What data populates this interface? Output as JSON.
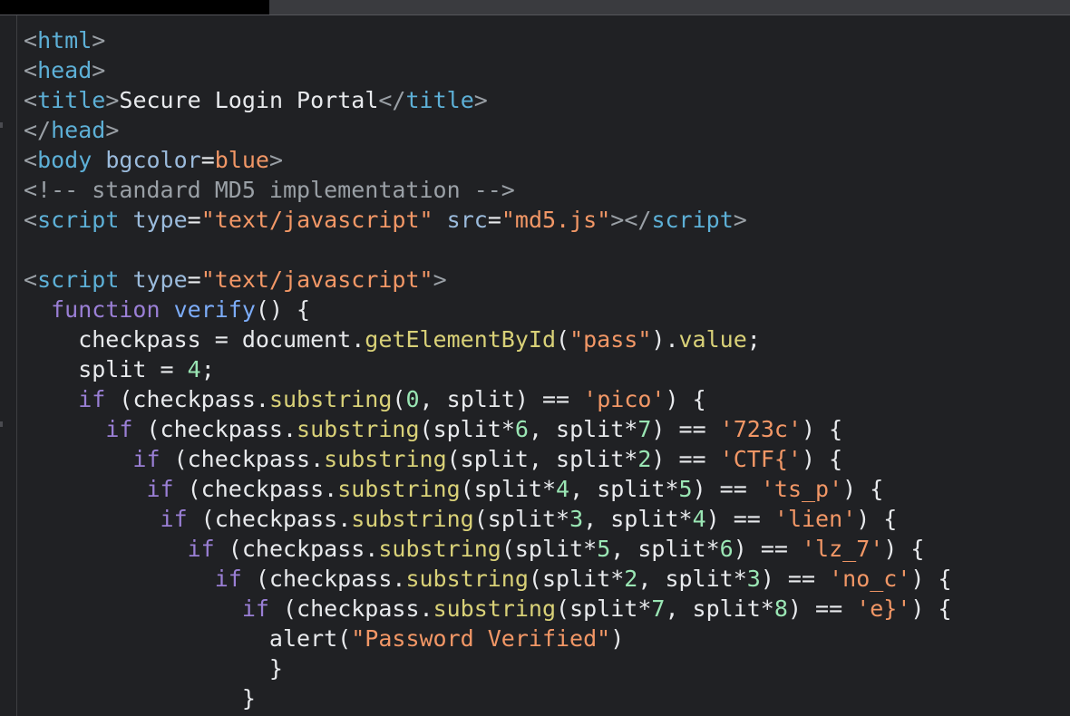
{
  "code_lines": [
    [
      [
        "br",
        "<"
      ],
      [
        "tag",
        "html"
      ],
      [
        "br",
        ">"
      ]
    ],
    [
      [
        "br",
        "<"
      ],
      [
        "tag",
        "head"
      ],
      [
        "br",
        ">"
      ]
    ],
    [
      [
        "br",
        "<"
      ],
      [
        "tag",
        "title"
      ],
      [
        "br",
        ">"
      ],
      [
        "txt",
        "Secure Login Portal"
      ],
      [
        "br",
        "</"
      ],
      [
        "tag",
        "title"
      ],
      [
        "br",
        ">"
      ]
    ],
    [
      [
        "br",
        "</"
      ],
      [
        "tag",
        "head"
      ],
      [
        "br",
        ">"
      ]
    ],
    [
      [
        "br",
        "<"
      ],
      [
        "tag",
        "body"
      ],
      [
        "txt",
        " "
      ],
      [
        "attr",
        "bgcolor"
      ],
      [
        "op",
        "="
      ],
      [
        "str",
        "blue"
      ],
      [
        "br",
        ">"
      ]
    ],
    [
      [
        "cmt",
        "<!-- standard MD5 implementation -->"
      ]
    ],
    [
      [
        "br",
        "<"
      ],
      [
        "tag",
        "script"
      ],
      [
        "txt",
        " "
      ],
      [
        "attr",
        "type"
      ],
      [
        "op",
        "="
      ],
      [
        "str",
        "\"text/javascript\""
      ],
      [
        "txt",
        " "
      ],
      [
        "attr",
        "src"
      ],
      [
        "op",
        "="
      ],
      [
        "str",
        "\"md5.js\""
      ],
      [
        "br",
        "></"
      ],
      [
        "tag",
        "script"
      ],
      [
        "br",
        ">"
      ]
    ],
    [],
    [
      [
        "br",
        "<"
      ],
      [
        "tag",
        "script"
      ],
      [
        "txt",
        " "
      ],
      [
        "attr",
        "type"
      ],
      [
        "op",
        "="
      ],
      [
        "str",
        "\"text/javascript\""
      ],
      [
        "br",
        ">"
      ]
    ],
    [
      [
        "txt",
        "  "
      ],
      [
        "kw",
        "function"
      ],
      [
        "txt",
        " "
      ],
      [
        "fn",
        "verify"
      ],
      [
        "txt",
        "() {"
      ]
    ],
    [
      [
        "txt",
        "    checkpass = document."
      ],
      [
        "meth",
        "getElementById"
      ],
      [
        "txt",
        "("
      ],
      [
        "str",
        "\"pass\""
      ],
      [
        "txt",
        ")."
      ],
      [
        "meth",
        "value"
      ],
      [
        "txt",
        ";"
      ]
    ],
    [
      [
        "txt",
        "    split = "
      ],
      [
        "num",
        "4"
      ],
      [
        "txt",
        ";"
      ]
    ],
    [
      [
        "txt",
        "    "
      ],
      [
        "kw",
        "if"
      ],
      [
        "txt",
        " (checkpass."
      ],
      [
        "meth",
        "substring"
      ],
      [
        "txt",
        "("
      ],
      [
        "num",
        "0"
      ],
      [
        "txt",
        ", split) == "
      ],
      [
        "str",
        "'pico'"
      ],
      [
        "txt",
        ") {"
      ]
    ],
    [
      [
        "txt",
        "      "
      ],
      [
        "kw",
        "if"
      ],
      [
        "txt",
        " (checkpass."
      ],
      [
        "meth",
        "substring"
      ],
      [
        "txt",
        "(split*"
      ],
      [
        "num",
        "6"
      ],
      [
        "txt",
        ", split*"
      ],
      [
        "num",
        "7"
      ],
      [
        "txt",
        ") == "
      ],
      [
        "str",
        "'723c'"
      ],
      [
        "txt",
        ") {"
      ]
    ],
    [
      [
        "txt",
        "        "
      ],
      [
        "kw",
        "if"
      ],
      [
        "txt",
        " (checkpass."
      ],
      [
        "meth",
        "substring"
      ],
      [
        "txt",
        "(split, split*"
      ],
      [
        "num",
        "2"
      ],
      [
        "txt",
        ") == "
      ],
      [
        "str",
        "'CTF{'"
      ],
      [
        "txt",
        ") {"
      ]
    ],
    [
      [
        "txt",
        "         "
      ],
      [
        "kw",
        "if"
      ],
      [
        "txt",
        " (checkpass."
      ],
      [
        "meth",
        "substring"
      ],
      [
        "txt",
        "(split*"
      ],
      [
        "num",
        "4"
      ],
      [
        "txt",
        ", split*"
      ],
      [
        "num",
        "5"
      ],
      [
        "txt",
        ") == "
      ],
      [
        "str",
        "'ts_p'"
      ],
      [
        "txt",
        ") {"
      ]
    ],
    [
      [
        "txt",
        "          "
      ],
      [
        "kw",
        "if"
      ],
      [
        "txt",
        " (checkpass."
      ],
      [
        "meth",
        "substring"
      ],
      [
        "txt",
        "(split*"
      ],
      [
        "num",
        "3"
      ],
      [
        "txt",
        ", split*"
      ],
      [
        "num",
        "4"
      ],
      [
        "txt",
        ") == "
      ],
      [
        "str",
        "'lien'"
      ],
      [
        "txt",
        ") {"
      ]
    ],
    [
      [
        "txt",
        "            "
      ],
      [
        "kw",
        "if"
      ],
      [
        "txt",
        " (checkpass."
      ],
      [
        "meth",
        "substring"
      ],
      [
        "txt",
        "(split*"
      ],
      [
        "num",
        "5"
      ],
      [
        "txt",
        ", split*"
      ],
      [
        "num",
        "6"
      ],
      [
        "txt",
        ") == "
      ],
      [
        "str",
        "'lz_7'"
      ],
      [
        "txt",
        ") {"
      ]
    ],
    [
      [
        "txt",
        "              "
      ],
      [
        "kw",
        "if"
      ],
      [
        "txt",
        " (checkpass."
      ],
      [
        "meth",
        "substring"
      ],
      [
        "txt",
        "(split*"
      ],
      [
        "num",
        "2"
      ],
      [
        "txt",
        ", split*"
      ],
      [
        "num",
        "3"
      ],
      [
        "txt",
        ") == "
      ],
      [
        "str",
        "'no_c'"
      ],
      [
        "txt",
        ") {"
      ]
    ],
    [
      [
        "txt",
        "                "
      ],
      [
        "kw",
        "if"
      ],
      [
        "txt",
        " (checkpass."
      ],
      [
        "meth",
        "substring"
      ],
      [
        "txt",
        "(split*"
      ],
      [
        "num",
        "7"
      ],
      [
        "txt",
        ", split*"
      ],
      [
        "num",
        "8"
      ],
      [
        "txt",
        ") == "
      ],
      [
        "str",
        "'e}'"
      ],
      [
        "txt",
        ") {"
      ]
    ],
    [
      [
        "txt",
        "                  alert("
      ],
      [
        "str",
        "\"Password Verified\""
      ],
      [
        "txt",
        ")"
      ]
    ],
    [
      [
        "txt",
        "                  }"
      ]
    ],
    [
      [
        "txt",
        "                }"
      ]
    ]
  ],
  "colors": {
    "background": "#202124",
    "tag": "#5db0d7",
    "attribute": "#9bbbdc",
    "string": "#f29766",
    "comment": "#9aa0a6",
    "keyword": "#9a7fd5",
    "function": "#7cacf8",
    "method": "#d9d178",
    "number": "#9ae6b4",
    "text": "#e8eaed"
  }
}
